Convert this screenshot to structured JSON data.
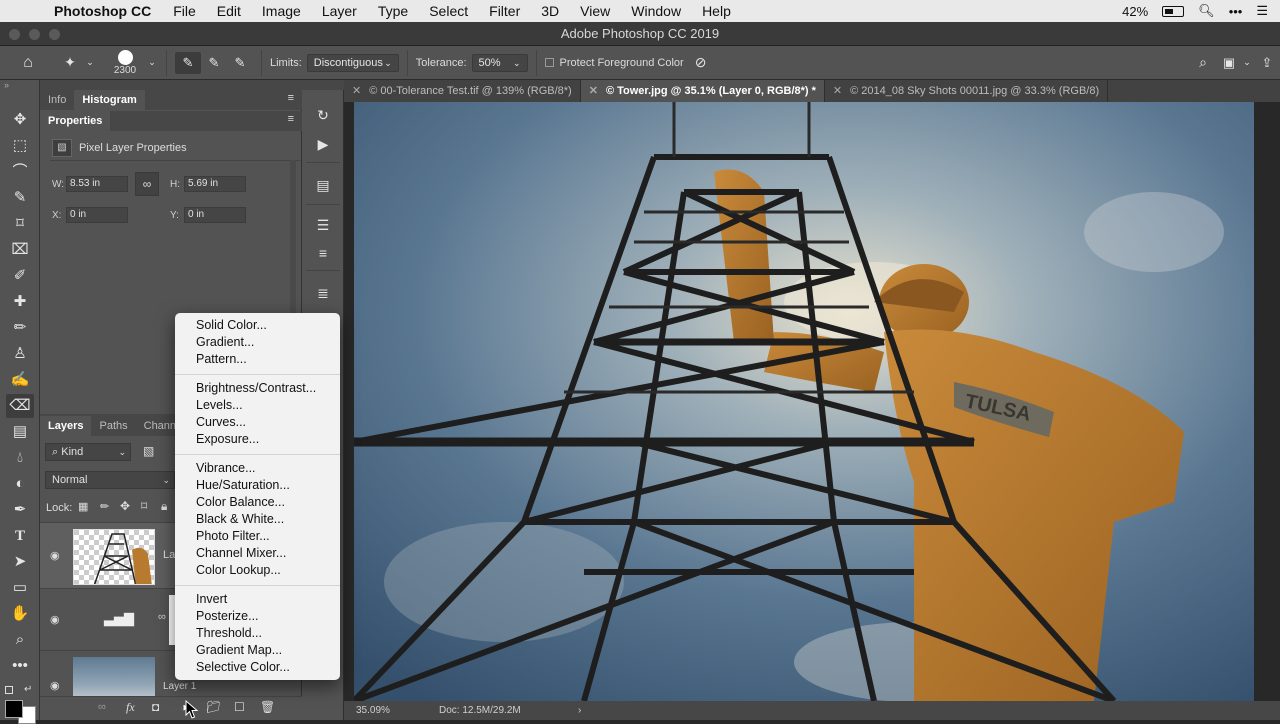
{
  "mac_menu": {
    "app_name": "Photoshop CC",
    "items": [
      "File",
      "Edit",
      "Image",
      "Layer",
      "Type",
      "Select",
      "Filter",
      "3D",
      "View",
      "Window",
      "Help"
    ],
    "battery": "42%"
  },
  "window_title": "Adobe Photoshop CC 2019",
  "options_bar": {
    "brush_size": "2300",
    "limits_label": "Limits:",
    "limits_value": "Discontiguous",
    "tolerance_label": "Tolerance:",
    "tolerance_value": "50%",
    "protect_label": "Protect Foreground Color"
  },
  "panels": {
    "top_tabs": [
      "Info",
      "Histogram"
    ],
    "properties_title": "Properties",
    "pixel_layer_label": "Pixel Layer Properties",
    "w_label": "W:",
    "w_value": "8.53 in",
    "h_label": "H:",
    "h_value": "5.69 in",
    "x_label": "X:",
    "x_value": "0 in",
    "y_label": "Y:",
    "y_value": "0 in",
    "layers_tabs": [
      "Layers",
      "Paths",
      "Channe"
    ],
    "kind_label": "Kind",
    "blend_mode": "Normal",
    "lock_label": "Lock:",
    "layer_name_partial": "La",
    "layer1_name": "Layer 1"
  },
  "doc_tabs": [
    {
      "label": "© 00-Tolerance Test.tif @ 139% (RGB/8*)",
      "active": false
    },
    {
      "label": "© Tower.jpg @ 35.1% (Layer 0, RGB/8*) *",
      "active": true
    },
    {
      "label": "© 2014_08 Sky Shots 00011.jpg @ 33.3% (RGB/8)",
      "active": false
    }
  ],
  "canvas": {
    "statue_text": "TULSA"
  },
  "status": {
    "zoom": "35.09%",
    "doc": "Doc: 12.5M/29.2M"
  },
  "adjustment_menu": {
    "group1": [
      "Solid Color...",
      "Gradient...",
      "Pattern..."
    ],
    "group2": [
      "Brightness/Contrast...",
      "Levels...",
      "Curves...",
      "Exposure..."
    ],
    "group3": [
      "Vibrance...",
      "Hue/Saturation...",
      "Color Balance...",
      "Black & White...",
      "Photo Filter...",
      "Channel Mixer...",
      "Color Lookup..."
    ],
    "group4": [
      "Invert",
      "Posterize...",
      "Threshold...",
      "Gradient Map...",
      "Selective Color..."
    ]
  },
  "colors": {
    "accent_statue": "#b77a2f",
    "sky": "#4d6a87",
    "ui_panel": "#535353"
  }
}
